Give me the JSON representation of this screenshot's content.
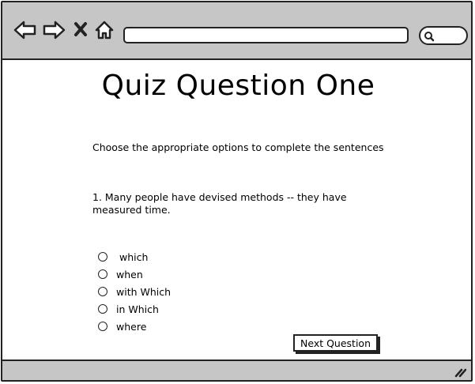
{
  "browser": {
    "back_icon": "arrow-left-icon",
    "forward_icon": "arrow-right-icon",
    "close_icon": "x-icon",
    "home_icon": "home-icon",
    "search_icon": "magnifier-icon",
    "url": ""
  },
  "page": {
    "title": "Quiz Question One",
    "instructions": "Choose the appropriate options to complete the sentences",
    "question": "1. Many people have devised methods -- they have measured time.",
    "options": [
      " which",
      "when",
      "with Which",
      "in Which",
      "where"
    ],
    "next_button": "Next Question"
  },
  "colors": {
    "chrome": "#c6c6c6",
    "border": "#222222",
    "background": "#ffffff"
  }
}
